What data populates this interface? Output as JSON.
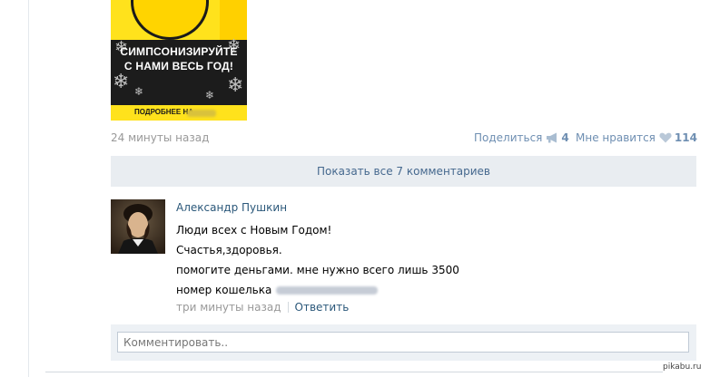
{
  "promo": {
    "line1": "СИМПСОНИЗИРУЙТЕ",
    "line2": "С НАМИ ВЕСЬ ГОД!",
    "more": "ПОДРОБНЕЕ НА"
  },
  "post": {
    "time": "24 минуты назад",
    "share_label": "Поделиться",
    "share_count": "4",
    "like_label": "Мне нравится",
    "like_count": "114"
  },
  "comments": {
    "show_all": "Показать все 7 комментариев"
  },
  "comment": {
    "author": "Александр Пушкин",
    "lines": [
      "Люди всех с Новым Годом!",
      "Счастья,здоровья.",
      "помогите деньгами. мне нужно всего лишь 3500",
      "номер кошелька"
    ],
    "time": "три минуты назад",
    "reply": "Ответить"
  },
  "reply_box": {
    "placeholder": "Комментировать.."
  },
  "watermark": "pikabu.ru",
  "colors": {
    "link": "#2b587a",
    "meta": "#999999",
    "accent": "#6f8fb2",
    "panel": "#e9edf1",
    "promo_yellow": "#ffe21c"
  }
}
